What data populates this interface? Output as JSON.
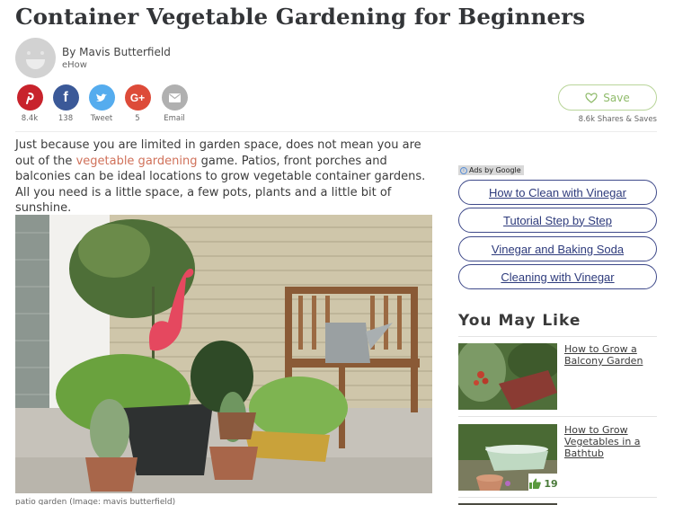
{
  "article": {
    "title": "Container Vegetable Gardening for Beginners",
    "author": "By Mavis Butterfield",
    "source": "eHow",
    "intro_part1": "Just because you are limited in garden space, does not mean you are out of the ",
    "intro_link": "vegetable gardening",
    "intro_part2": " game. Patios, front porches and balconies can be ideal locations to grow vegetable container gardens. All you need is a little space, a few pots, plants and a little bit of sunshine.",
    "image_alt": "patio garden with pink flamingo, potted plants, wooden bench and watering can",
    "caption": "patio garden (Image: mavis butterfield)"
  },
  "share": {
    "buttons": [
      {
        "network": "pinterest",
        "icon": "pinterest-icon",
        "glyph": "P",
        "count": "8.4k",
        "color": "#c8232c"
      },
      {
        "network": "facebook",
        "icon": "facebook-icon",
        "glyph": "f",
        "count": "138",
        "color": "#3b5998"
      },
      {
        "network": "twitter",
        "icon": "twitter-icon",
        "glyph": "🐦",
        "count": "Tweet",
        "color": "#55acee"
      },
      {
        "network": "google-plus",
        "icon": "google-plus-icon",
        "glyph": "G+",
        "count": "5",
        "color": "#dd4b39"
      },
      {
        "network": "email",
        "icon": "email-icon",
        "glyph": "✉",
        "count": "Email",
        "color": "#b0b0b0"
      }
    ],
    "save_label": "Save",
    "save_meta": "8.6k Shares & Saves"
  },
  "ads": {
    "label": "Ads by Google",
    "links": [
      "How to Clean with Vinegar",
      "Tutorial Step by Step",
      "Vinegar and Baking Soda",
      "Cleaning with Vinegar"
    ]
  },
  "you_may_like": {
    "title": "You May Like",
    "items": [
      {
        "title": "How to Grow a Balcony Garden"
      },
      {
        "title": "How to Grow Vegetables in a Bathtub",
        "likes": "19"
      }
    ]
  },
  "colors": {
    "link": "#d0715a",
    "save_green": "#8fbb6a",
    "ad_border": "#3f4a8a"
  }
}
